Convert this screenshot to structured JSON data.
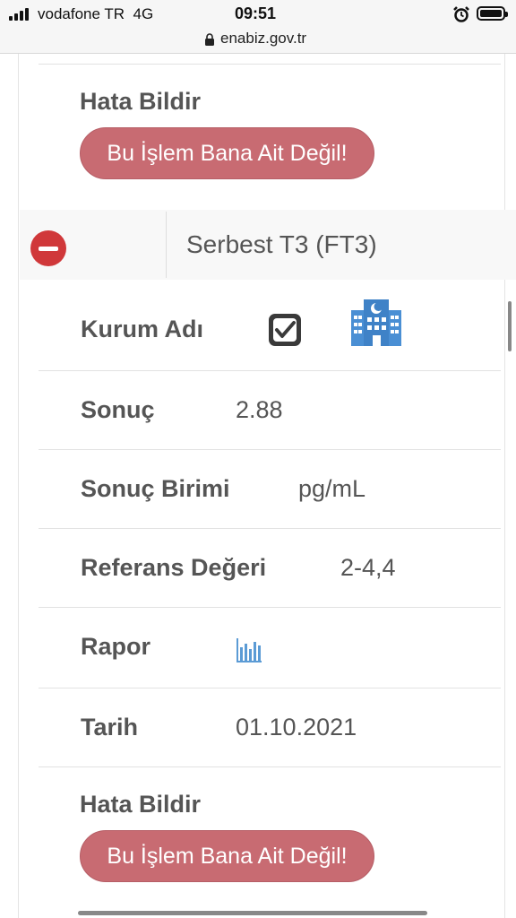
{
  "status_bar": {
    "carrier": "vodafone TR",
    "network": "4G",
    "time": "09:51"
  },
  "browser": {
    "url": "enabiz.gov.tr"
  },
  "top_section": {
    "error_label": "Hata Bildir",
    "error_button": "Bu İşlem Bana Ait Değil!"
  },
  "test": {
    "name": "Serbest T3 (FT3)",
    "institution_label": "Kurum Adı",
    "result_label": "Sonuç",
    "result_value": "2.88",
    "unit_label": "Sonuç Birimi",
    "unit_value": "pg/mL",
    "reference_label": "Referans Değeri",
    "reference_value": "2-4,4",
    "report_label": "Rapor",
    "date_label": "Tarih",
    "date_value": "01.10.2021",
    "error_label": "Hata Bildir",
    "error_button": "Bu İşlem Bana Ait Değil!"
  },
  "colors": {
    "error_button": "#c86b72",
    "remove_icon": "#d0383a",
    "hospital_icon": "#4a8fd4"
  },
  "icons": {
    "institution_checkbox": "checkmark-checkbox-icon",
    "hospital": "hospital-icon",
    "report": "bar-chart-icon",
    "collapse": "minus-circle-icon"
  }
}
